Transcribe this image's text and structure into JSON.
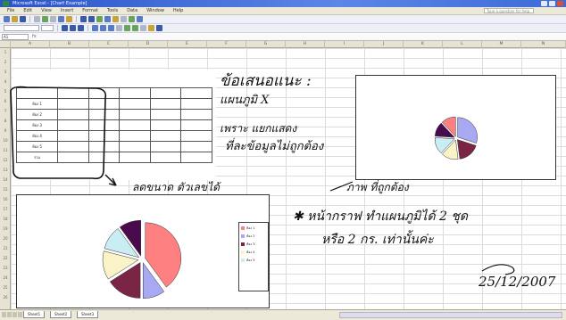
{
  "app": {
    "title": "Microsoft Excel - [Chart Example]",
    "menus": [
      "File",
      "Edit",
      "View",
      "Insert",
      "Format",
      "Tools",
      "Data",
      "Window",
      "Help"
    ],
    "help_placeholder": "Type a question for help",
    "name_box": "A1",
    "fx_label": "fx"
  },
  "columns": [
    "A",
    "B",
    "C",
    "D",
    "E",
    "F",
    "G",
    "H",
    "I",
    "J",
    "K",
    "L",
    "M",
    "N"
  ],
  "rows": [
    "1",
    "2",
    "3",
    "4",
    "5",
    "6",
    "7",
    "8",
    "9",
    "10",
    "11",
    "12",
    "13",
    "14",
    "15",
    "16",
    "17",
    "18",
    "19",
    "20",
    "21",
    "22",
    "23",
    "24",
    "25",
    "26"
  ],
  "table": {
    "title": "",
    "subtitle": "",
    "row_labels": [
      "ห้อง 1",
      "ห้อง 2",
      "ห้อง 3",
      "ห้อง 4",
      "ห้อง 5",
      "รวม"
    ],
    "cells": [
      [
        "",
        "",
        "",
        "",
        ""
      ],
      [
        "",
        "",
        "",
        "",
        ""
      ],
      [
        "",
        "",
        "",
        "",
        ""
      ],
      [
        "",
        "",
        "",
        "",
        ""
      ],
      [
        "",
        "",
        "",
        "",
        ""
      ],
      [
        "",
        "",
        "",
        "",
        ""
      ]
    ]
  },
  "handwriting": {
    "line1": "ข้อเสนอแนะ :",
    "line2": "แผนภูมิ X",
    "line3": "เพราะ แยกแสดง",
    "line4": "ที่ละข้อมูลไม่ถูกต้อง",
    "line5": "ลดขนาด ตัวเลขได้",
    "line6": "ภาพ ที่ถูกต้อง",
    "line7": "✱ หน้ากราฟ ทำแผนภูมิได้ 2 ชุด",
    "line8": "หรือ 2 กร. เท่านั้นค่ะ",
    "date": "25/12/2007"
  },
  "chart_data": [
    {
      "type": "pie",
      "title": "",
      "values": [
        30,
        18,
        14,
        14,
        12,
        12
      ],
      "colors": [
        "#a9a8f2",
        "#7a2446",
        "#fbf3c8",
        "#c8edf3",
        "#4a0a4e",
        "#ff8080"
      ]
    },
    {
      "type": "pie",
      "title": "",
      "values": [
        40,
        10,
        16,
        13,
        11,
        10
      ],
      "colors": [
        "#ff8080",
        "#a9a8f2",
        "#7a2446",
        "#fbf3c8",
        "#c8edf3",
        "#4a0a4e"
      ],
      "legend": [
        "ห้อง 1",
        "ห้อง 2",
        "ห้อง 3",
        "ห้อง 4",
        "ห้อง 5"
      ]
    }
  ],
  "sheet_tabs": [
    "Sheet1",
    "Sheet2",
    "Sheet3"
  ]
}
